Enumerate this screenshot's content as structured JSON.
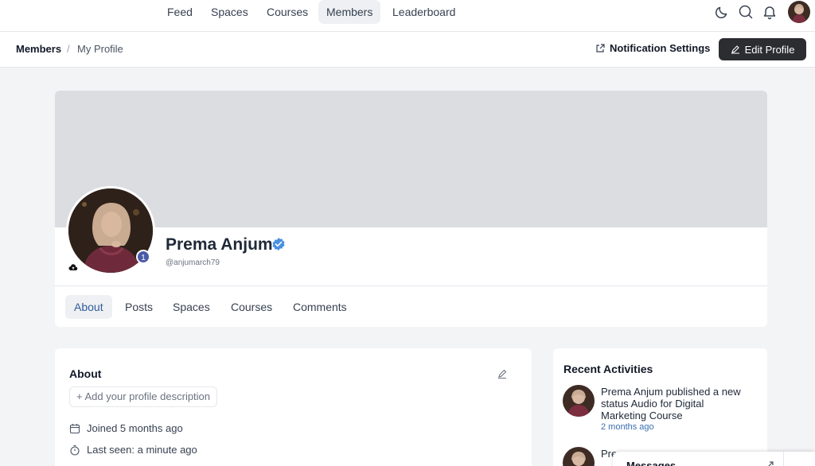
{
  "nav": {
    "items": [
      {
        "label": "Feed",
        "active": false
      },
      {
        "label": "Spaces",
        "active": false
      },
      {
        "label": "Courses",
        "active": false
      },
      {
        "label": "Members",
        "active": true
      },
      {
        "label": "Leaderboard",
        "active": false
      }
    ],
    "icons": [
      "moon-icon",
      "search-icon",
      "bell-icon"
    ]
  },
  "breadcrumb": {
    "root": "Members",
    "separator": "/",
    "current": "My Profile"
  },
  "actions": {
    "notification_settings": "Notification Settings",
    "edit_profile": "Edit Profile"
  },
  "profile": {
    "name": "Prema Anjum",
    "handle": "@anjumarch79",
    "level": "1",
    "verified": true,
    "tabs": [
      {
        "label": "About",
        "active": true
      },
      {
        "label": "Posts",
        "active": false
      },
      {
        "label": "Spaces",
        "active": false
      },
      {
        "label": "Courses",
        "active": false
      },
      {
        "label": "Comments",
        "active": false
      }
    ]
  },
  "about": {
    "title": "About",
    "add_description": "+ Add your profile description",
    "joined": "Joined 5 months ago",
    "last_seen": "Last seen: a minute ago"
  },
  "recent": {
    "title": "Recent Activities",
    "items": [
      {
        "actor": "Prema Anjum",
        "action": " published a new status ",
        "object": "Audio for Digital Marketing Course",
        "time": "2 months ago"
      },
      {
        "actor": "Prem",
        "action": "",
        "object": "",
        "time": ""
      }
    ]
  },
  "messages": {
    "label": "Messages"
  },
  "colors": {
    "accent": "#3b6fb0",
    "dark_button": "#2b2d31",
    "verified": "#4a90e2",
    "badge": "#4b5aa8"
  }
}
